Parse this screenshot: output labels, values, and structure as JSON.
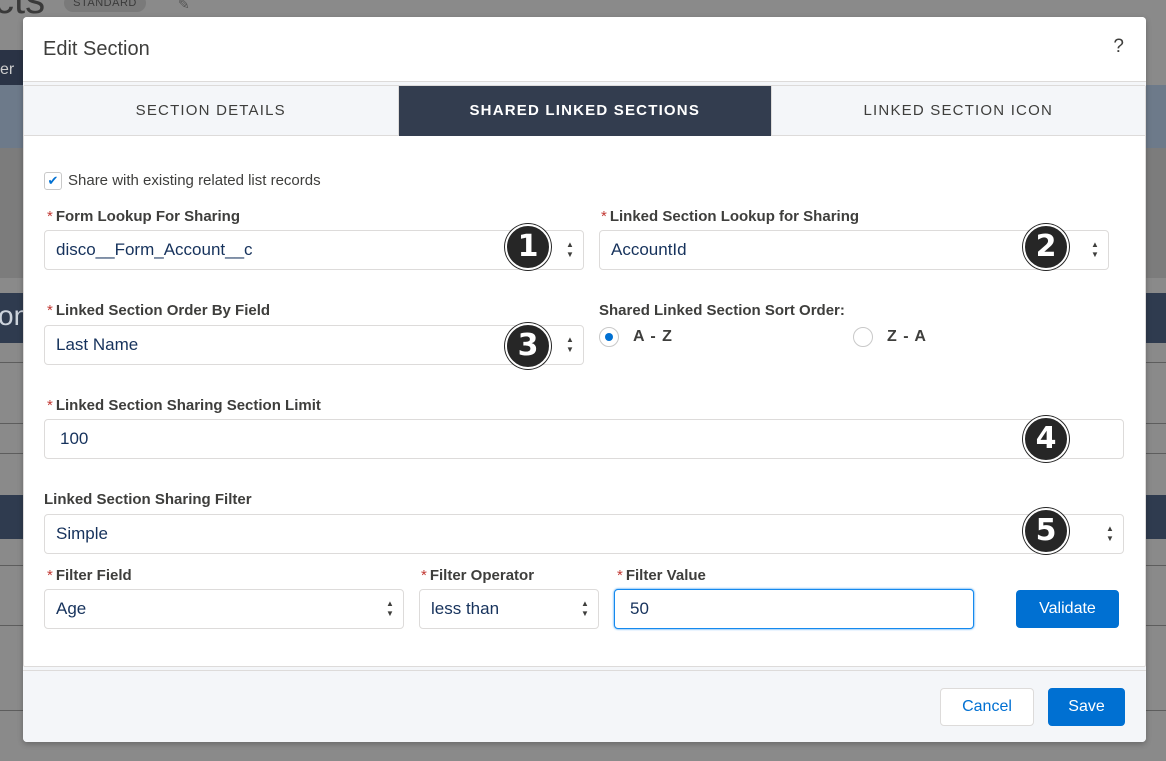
{
  "background": {
    "page_title_fragment": "cts",
    "badge": "STANDARD",
    "tab_fragment": "er",
    "section_fragment": "on"
  },
  "modal": {
    "title": "Edit Section",
    "help": "?",
    "tabs": [
      {
        "label": "SECTION DETAILS",
        "active": false
      },
      {
        "label": "SHARED LINKED SECTIONS",
        "active": true
      },
      {
        "label": "LINKED SECTION ICON",
        "active": false
      }
    ],
    "share_checkbox": {
      "label": "Share with existing related list records",
      "checked": true,
      "mark": "✔"
    },
    "form_lookup": {
      "label": "Form Lookup For Sharing",
      "required": "*",
      "value": "disco__Form_Account__c"
    },
    "linked_lookup": {
      "label": "Linked Section Lookup for Sharing",
      "required": "*",
      "value": "AccountId"
    },
    "order_by": {
      "label": "Linked Section Order By Field",
      "required": "*",
      "value": "Last Name"
    },
    "sort_order": {
      "label": "Shared Linked Section Sort Order:",
      "options": [
        {
          "label": "A - Z",
          "checked": true
        },
        {
          "label": "Z - A",
          "checked": false
        }
      ]
    },
    "section_limit": {
      "label": "Linked Section Sharing Section Limit",
      "required": "*",
      "value": "100"
    },
    "sharing_filter": {
      "label": "Linked Section Sharing Filter",
      "value": "Simple"
    },
    "filter_field": {
      "label": "Filter Field",
      "required": "*",
      "value": "Age"
    },
    "filter_operator": {
      "label": "Filter Operator",
      "required": "*",
      "value": "less than"
    },
    "filter_value": {
      "label": "Filter Value",
      "required": "*",
      "value": "50"
    },
    "validate_label": "Validate",
    "cancel_label": "Cancel",
    "save_label": "Save",
    "markers": [
      "1",
      "2",
      "3",
      "4",
      "5"
    ],
    "stepper": {
      "up": "▲",
      "down": "▼"
    }
  },
  "colors": {
    "brand": "#0070d2",
    "active_tab": "#333d4f",
    "required": "#c23934",
    "marker": "#262626"
  }
}
